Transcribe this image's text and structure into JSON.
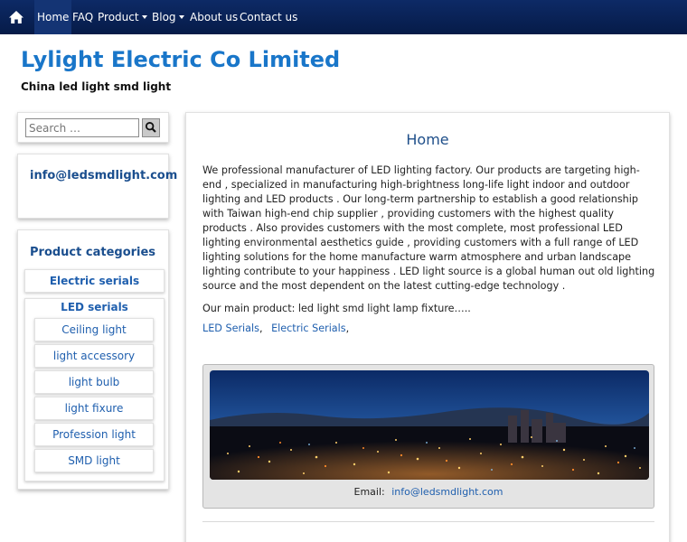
{
  "nav": {
    "home_icon": "home-icon",
    "items": [
      {
        "label": "Home",
        "active": true
      },
      {
        "label": "FAQ"
      },
      {
        "label": "Product",
        "dropdown": true
      },
      {
        "label": "Blog",
        "dropdown": true
      },
      {
        "label": "About us"
      },
      {
        "label": "Contact us"
      }
    ]
  },
  "header": {
    "title": "Lylight Electric Co Limited",
    "tagline": "China led light smd light"
  },
  "sidebar": {
    "search": {
      "placeholder": "Search …",
      "button_icon": "search-icon"
    },
    "email_widget": {
      "email": "info@ledsmdlight.com"
    },
    "categories": {
      "title": "Product categories",
      "items": [
        {
          "label": "Electric serials"
        },
        {
          "label": "LED serials",
          "children": [
            {
              "label": "Ceiling light"
            },
            {
              "label": "light accessory"
            },
            {
              "label": "light bulb"
            },
            {
              "label": "light fixure"
            },
            {
              "label": "Profession light"
            },
            {
              "label": "SMD light"
            }
          ]
        }
      ]
    }
  },
  "main": {
    "title": "Home",
    "intro": "We professional manufacturer of LED lighting factory. Our products are targeting high-end , specialized in manufacturing high-brightness long-life light  indoor and outdoor lighting and LED products . Our long-term partnership to establish a good relationship with Taiwan high-end chip supplier , providing customers with the highest quality products . Also provides customers with the most complete, most professional LED lighting environmental aesthetics guide , providing customers with a full range of LED lighting solutions for the home manufacture warm atmosphere and urban landscape lighting contribute to your happiness . LED light source is a global human out old lighting source and the most dependent on the latest cutting-edge technology .",
    "main_product": "Our main product: led light smd light lamp fixture…..",
    "tags": [
      {
        "label": "LED Serials"
      },
      {
        "label": "Electric Serials"
      }
    ],
    "tag_separator": ",",
    "banner": {
      "caption_label": "Email:",
      "caption_email": "info@ledsmdlight.com"
    }
  },
  "colors": {
    "nav_bg": "#0d2a66",
    "title_blue": "#1976c9",
    "link_blue": "#1f5fae"
  }
}
